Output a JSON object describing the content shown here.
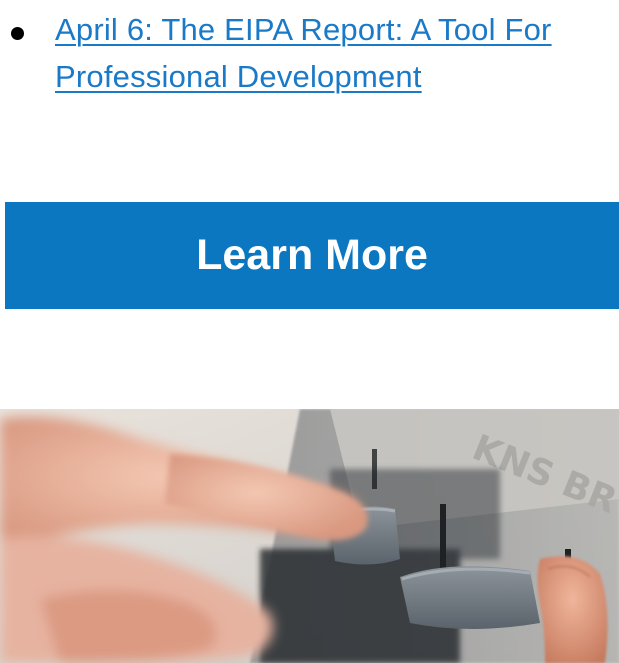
{
  "events": {
    "items": [
      {
        "label": "April 6: The EIPA Report: A Tool For \nProfessional Development"
      }
    ]
  },
  "cta": {
    "label": "Learn More",
    "color": "#0a77c0"
  },
  "photo": {
    "subject": "hands-pressing-braille-writer-keys"
  },
  "colors": {
    "link": "#1a7ac8",
    "background": "#ffffff"
  }
}
